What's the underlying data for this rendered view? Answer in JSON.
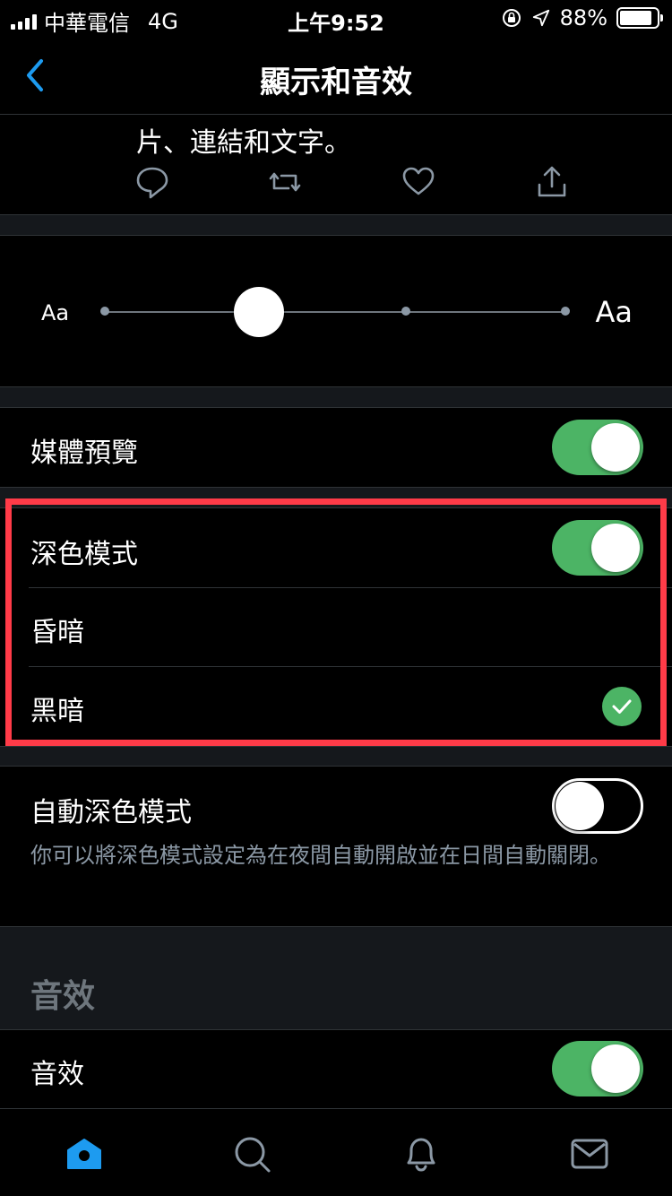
{
  "status_bar": {
    "carrier": "中華電信",
    "network": "4G",
    "time": "上午9:52",
    "battery": "88%"
  },
  "nav": {
    "back_icon": "chevron-left-icon",
    "title": "顯示和音效"
  },
  "tweet_preview": {
    "text": "片、連結和文字。",
    "actions": [
      "reply-icon",
      "retweet-icon",
      "like-icon",
      "share-icon"
    ]
  },
  "font_size": {
    "small_label": "Aa",
    "large_label": "Aa",
    "steps": 4,
    "selected_step": 1
  },
  "media_preview": {
    "label": "媒體預覽",
    "enabled": true
  },
  "dark_mode": {
    "label": "深色模式",
    "enabled": true,
    "options": [
      {
        "label": "昏暗",
        "selected": false
      },
      {
        "label": "黑暗",
        "selected": true
      }
    ]
  },
  "auto_dark_mode": {
    "label": "自動深色模式",
    "enabled": false,
    "description": "你可以將深色模式設定為在夜間自動開啟並在日間自動關閉。"
  },
  "sound_section": {
    "title": "音效",
    "sound_effects": {
      "label": "音效",
      "enabled": true
    }
  },
  "tabbar": {
    "items": [
      "home-icon",
      "search-icon",
      "notifications-icon",
      "messages-icon"
    ]
  },
  "colors": {
    "accent_blue": "#1d9bf0",
    "toggle_green": "#4cb465",
    "highlight_red": "#ff3b48"
  }
}
